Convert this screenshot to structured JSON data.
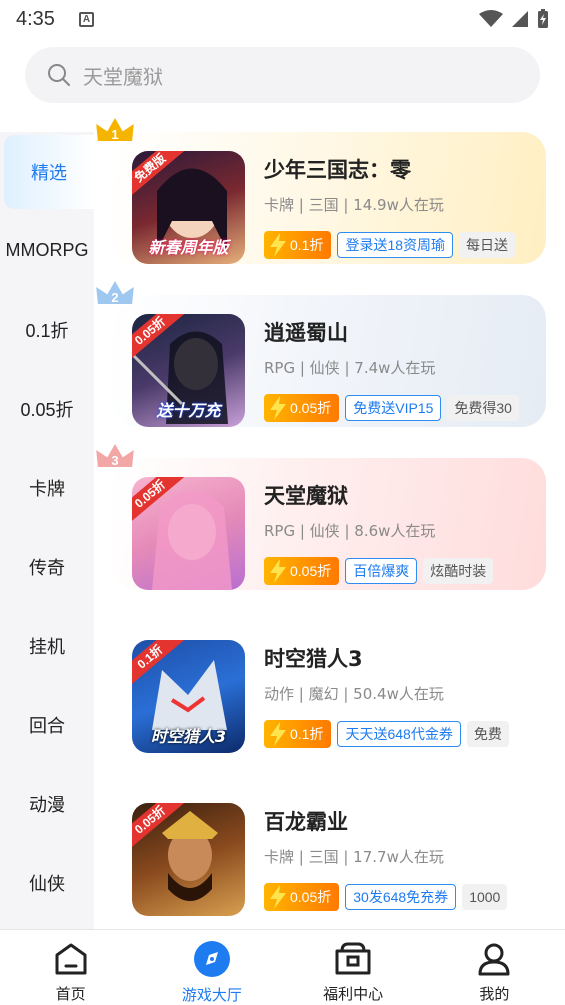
{
  "status_bar": {
    "time": "4:35",
    "notif_letter": "A"
  },
  "search": {
    "placeholder": "天堂魔狱"
  },
  "sidebar": {
    "items": [
      {
        "label": "精选",
        "active": true
      },
      {
        "label": "MMORPG"
      },
      {
        "label": "0.1折"
      },
      {
        "label": "0.05折"
      },
      {
        "label": "卡牌"
      },
      {
        "label": "传奇"
      },
      {
        "label": "挂机"
      },
      {
        "label": "回合"
      },
      {
        "label": "动漫"
      },
      {
        "label": "仙侠"
      }
    ]
  },
  "games": [
    {
      "rank": "1",
      "thumb_tag": "免费版",
      "thumb_caption": "新春周年版",
      "title": "少年三国志：零",
      "meta": "卡牌 | 三国 | 14.9w人在玩",
      "discount": "0.1折",
      "welfare": "登录送18资周瑜",
      "extra": "每日送"
    },
    {
      "rank": "2",
      "thumb_tag": "0.05折",
      "thumb_caption": "送十万充",
      "title": "逍遥蜀山",
      "meta": "RPG | 仙侠 | 7.4w人在玩",
      "discount": "0.05折",
      "welfare": "免费送VIP15",
      "extra": "免费得30"
    },
    {
      "rank": "3",
      "thumb_tag": "0.05折",
      "thumb_caption": "",
      "title": "天堂魔狱",
      "meta": "RPG | 仙侠 | 8.6w人在玩",
      "discount": "0.05折",
      "welfare": "百倍爆爽",
      "extra": "炫酷时装"
    },
    {
      "rank": "",
      "thumb_tag": "0.1折",
      "thumb_caption": "时空猎人3",
      "title": "时空猎人3",
      "meta": "动作 | 魔幻 | 50.4w人在玩",
      "discount": "0.1折",
      "welfare": "天天送648代金券",
      "extra": "免费"
    },
    {
      "rank": "",
      "thumb_tag": "0.05折",
      "thumb_caption": "",
      "title": "百龙霸业",
      "meta": "卡牌 | 三国 | 17.7w人在玩",
      "discount": "0.05折",
      "welfare": "30发648免充券",
      "extra": "1000"
    }
  ],
  "bottom_nav": [
    {
      "label": "首页",
      "icon": "home-icon"
    },
    {
      "label": "游戏大厅",
      "icon": "game-hall-icon",
      "active": true
    },
    {
      "label": "福利中心",
      "icon": "welfare-box-icon"
    },
    {
      "label": "我的",
      "icon": "profile-icon"
    }
  ],
  "colors": {
    "accent": "#1e7bf0",
    "discount": "#ff8a00",
    "gold_crown": "#f5b400",
    "silver_crown": "#9ec8f0",
    "bronze_crown": "#f2a6a6"
  }
}
